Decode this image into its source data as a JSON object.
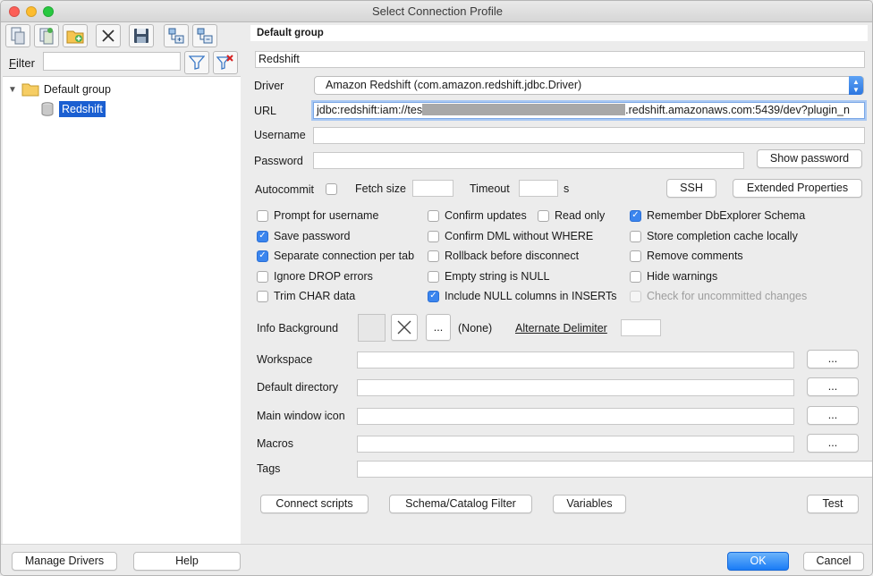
{
  "window": {
    "title": "Select Connection Profile"
  },
  "toolbar": {
    "buttons": [
      "new-profile-icon",
      "copy-profile-icon",
      "new-group-icon",
      "delete-icon",
      "save-icon",
      "expand-all-icon",
      "collapse-all-icon"
    ]
  },
  "filter": {
    "label": "Filter",
    "value": ""
  },
  "tree": {
    "group": "Default group",
    "profile": "Redshift"
  },
  "profile": {
    "group_header": "Default group",
    "name": "Redshift",
    "driver_label": "Driver",
    "driver_value": "Amazon Redshift (com.amazon.redshift.jdbc.Driver)",
    "url_label": "URL",
    "url_value": "jdbc:redshift:iam://tes",
    "url_value_suffix": ".redshift.amazonaws.com:5439/dev?plugin_n",
    "username_label": "Username",
    "password_label": "Password",
    "show_password": "Show password",
    "autocommit_label": "Autocommit",
    "fetch_size_label": "Fetch size",
    "timeout_label": "Timeout",
    "timeout_unit": "s",
    "ssh_button": "SSH",
    "extended_props_button": "Extended Properties"
  },
  "options": {
    "col1": [
      {
        "label": "Prompt for username",
        "checked": false
      },
      {
        "label": "Save password",
        "checked": true
      },
      {
        "label": "Separate connection per tab",
        "checked": true
      },
      {
        "label": "Ignore DROP errors",
        "checked": false
      },
      {
        "label": "Trim CHAR data",
        "checked": false
      }
    ],
    "col2": [
      {
        "label": "Confirm updates",
        "checked": false
      },
      {
        "label": "Confirm DML without WHERE",
        "checked": false
      },
      {
        "label": "Rollback before disconnect",
        "checked": false
      },
      {
        "label": "Empty string is NULL",
        "checked": false
      },
      {
        "label": "Include NULL columns in INSERTs",
        "checked": true
      }
    ],
    "read_only": {
      "label": "Read only",
      "checked": false
    },
    "col3": [
      {
        "label": "Remember DbExplorer Schema",
        "checked": true
      },
      {
        "label": "Store completion cache locally",
        "checked": false
      },
      {
        "label": "Remove comments",
        "checked": false
      },
      {
        "label": "Hide warnings",
        "checked": false
      },
      {
        "label": "Check for uncommitted changes",
        "checked": false,
        "disabled": true
      }
    ]
  },
  "extra": {
    "info_background_label": "Info Background",
    "browse_dots": "...",
    "none_text": "(None)",
    "alternate_delimiter_label": "Alternate Delimiter",
    "workspace_label": "Workspace",
    "default_directory_label": "Default directory",
    "main_window_icon_label": "Main window icon",
    "macros_label": "Macros",
    "tags_label": "Tags"
  },
  "actions": {
    "connect_scripts": "Connect scripts",
    "schema_filter": "Schema/Catalog Filter",
    "variables": "Variables",
    "test": "Test"
  },
  "footer": {
    "manage_drivers": "Manage Drivers",
    "help": "Help",
    "ok": "OK",
    "cancel": "Cancel"
  },
  "colors": {
    "accent": "#1b5fd1",
    "checkbox_on": "#3b85ee",
    "redact": "#a8a8a8"
  }
}
